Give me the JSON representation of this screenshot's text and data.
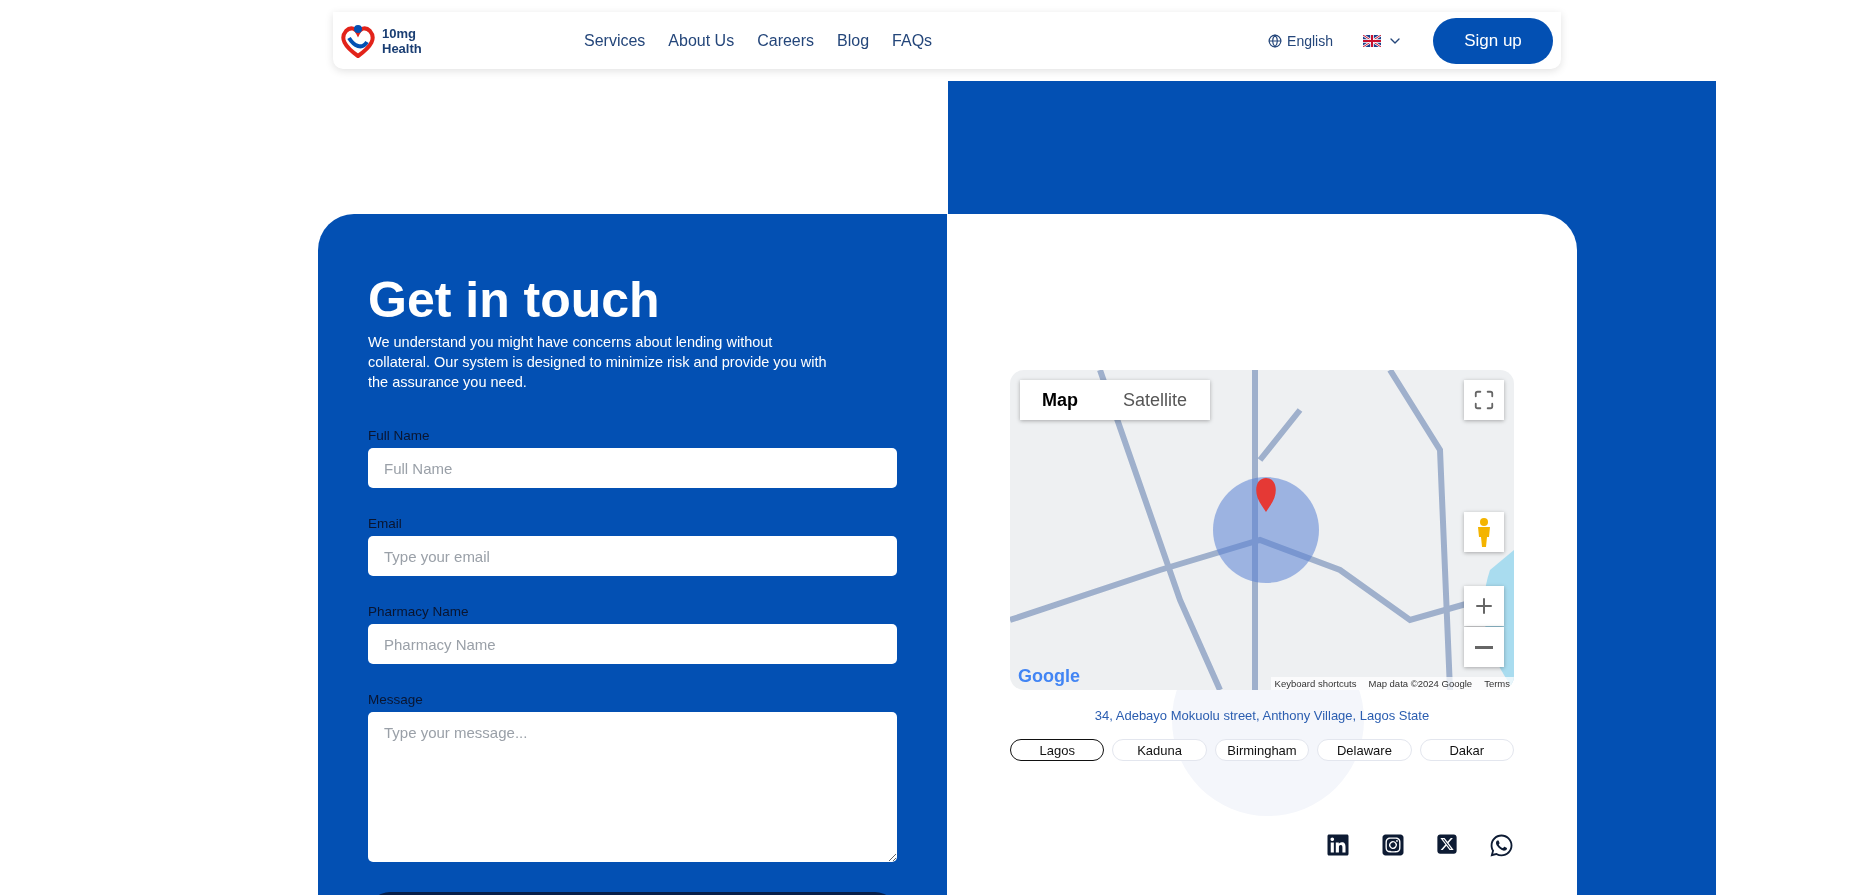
{
  "header": {
    "logo_text": [
      "10mg",
      "Health"
    ],
    "nav": [
      "Services",
      "About Us",
      "Careers",
      "Blog",
      "FAQs"
    ],
    "language": "English",
    "signup": "Sign up"
  },
  "contact": {
    "title": "Get in touch",
    "description": "We understand you might have concerns about lending without collateral. Our system is designed to minimize risk and provide you with the assurance you need.",
    "fields": [
      {
        "kind": "input",
        "label": "Full Name",
        "placeholder": "Full Name"
      },
      {
        "kind": "input",
        "label": "Email",
        "placeholder": "Type your email"
      },
      {
        "kind": "input",
        "label": "Pharmacy Name",
        "placeholder": "Pharmacy Name"
      },
      {
        "kind": "textarea",
        "label": "Message",
        "placeholder": "Type your message..."
      }
    ]
  },
  "map": {
    "types": [
      {
        "label": "Map",
        "selected": true
      },
      {
        "label": "Satellite",
        "selected": false
      }
    ],
    "logo": "Google",
    "attribution": [
      "Keyboard shortcuts",
      "Map data ©2024 Google",
      "Terms"
    ]
  },
  "address": "34, Adebayo Mokuolu street, Anthony Village, Lagos State",
  "locations": [
    {
      "label": "Lagos",
      "selected": true
    },
    {
      "label": "Kaduna",
      "selected": false
    },
    {
      "label": "Birmingham",
      "selected": false
    },
    {
      "label": "Delaware",
      "selected": false
    },
    {
      "label": "Dakar",
      "selected": false
    }
  ]
}
